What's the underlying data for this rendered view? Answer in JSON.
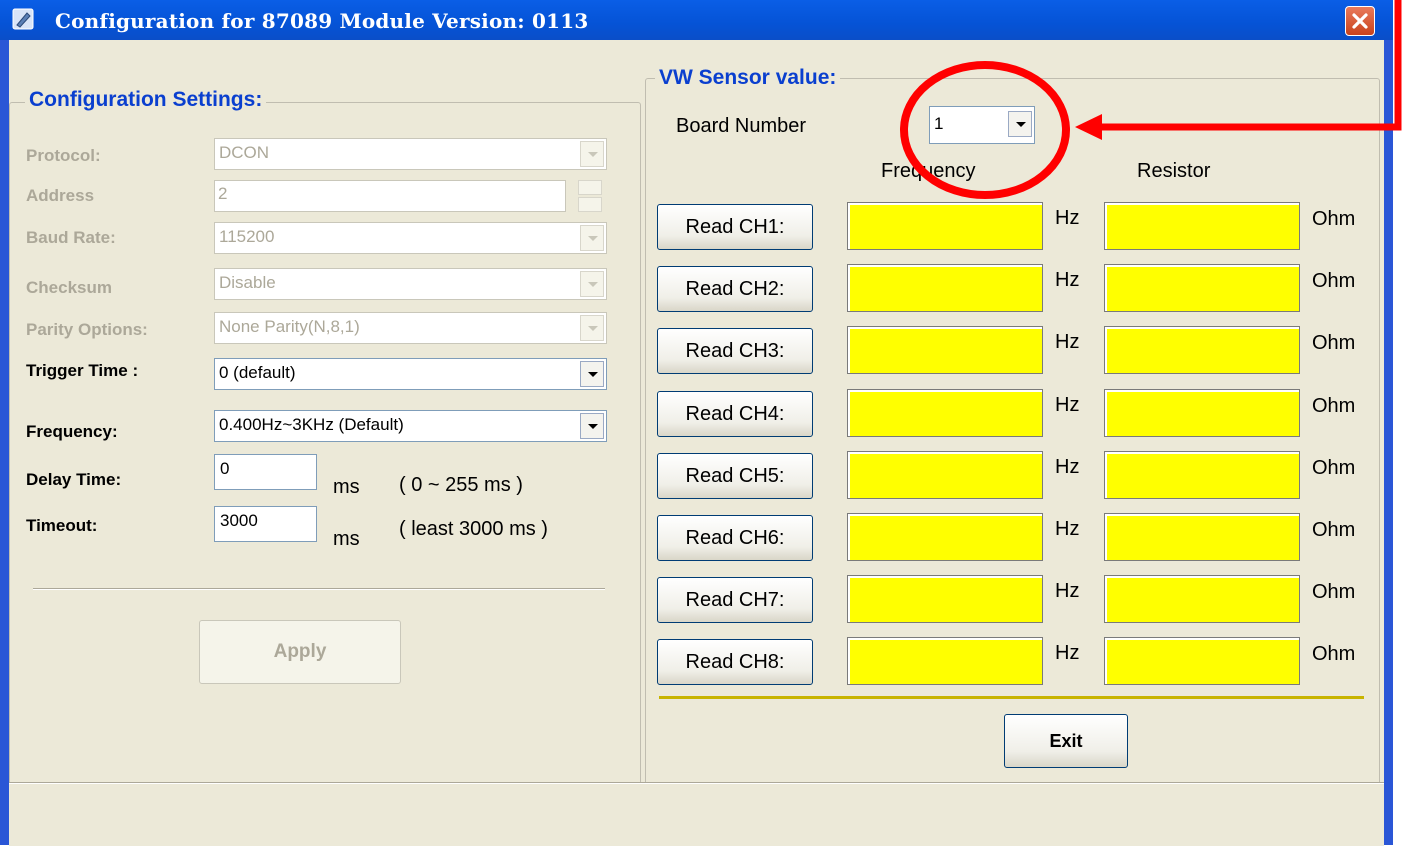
{
  "window": {
    "title": "Configuration for 87089 Module Version: 0113"
  },
  "config": {
    "legend": "Configuration Settings:",
    "protocol": {
      "label": "Protocol:",
      "value": "DCON"
    },
    "address": {
      "label": "Address",
      "value": "2"
    },
    "baud_rate": {
      "label": "Baud Rate:",
      "value": "115200"
    },
    "checksum": {
      "label": "Checksum",
      "value": "Disable"
    },
    "parity": {
      "label": "Parity Options:",
      "value": "None Parity(N,8,1)"
    },
    "trigger_time": {
      "label": "Trigger Time :",
      "value": "0 (default)"
    },
    "frequency": {
      "label": "Frequency:",
      "value": "0.400Hz~3KHz (Default)"
    },
    "delay_time": {
      "label": "Delay Time:",
      "value": "0",
      "unit": "ms",
      "hint": "( 0 ~ 255 ms )"
    },
    "timeout": {
      "label": "Timeout:",
      "value": "3000",
      "unit": "ms",
      "hint": "( least 3000 ms )"
    },
    "apply_label": "Apply"
  },
  "sensor": {
    "legend": "VW Sensor value:",
    "board_label": "Board Number",
    "board_value": "1",
    "col_frequency": "Frequency",
    "col_resistor": "Resistor",
    "unit_hz": "Hz",
    "unit_ohm": "Ohm",
    "channels": [
      {
        "button": "Read CH1:",
        "frequency": "",
        "resistor": ""
      },
      {
        "button": "Read CH2:",
        "frequency": "",
        "resistor": ""
      },
      {
        "button": "Read CH3:",
        "frequency": "",
        "resistor": ""
      },
      {
        "button": "Read CH4:",
        "frequency": "",
        "resistor": ""
      },
      {
        "button": "Read CH5:",
        "frequency": "",
        "resistor": ""
      },
      {
        "button": "Read CH6:",
        "frequency": "",
        "resistor": ""
      },
      {
        "button": "Read CH7:",
        "frequency": "",
        "resistor": ""
      },
      {
        "button": "Read CH8:",
        "frequency": "",
        "resistor": ""
      }
    ],
    "field_color": "#ffff00",
    "exit_label": "Exit"
  },
  "annotation_color": "#ff0000"
}
